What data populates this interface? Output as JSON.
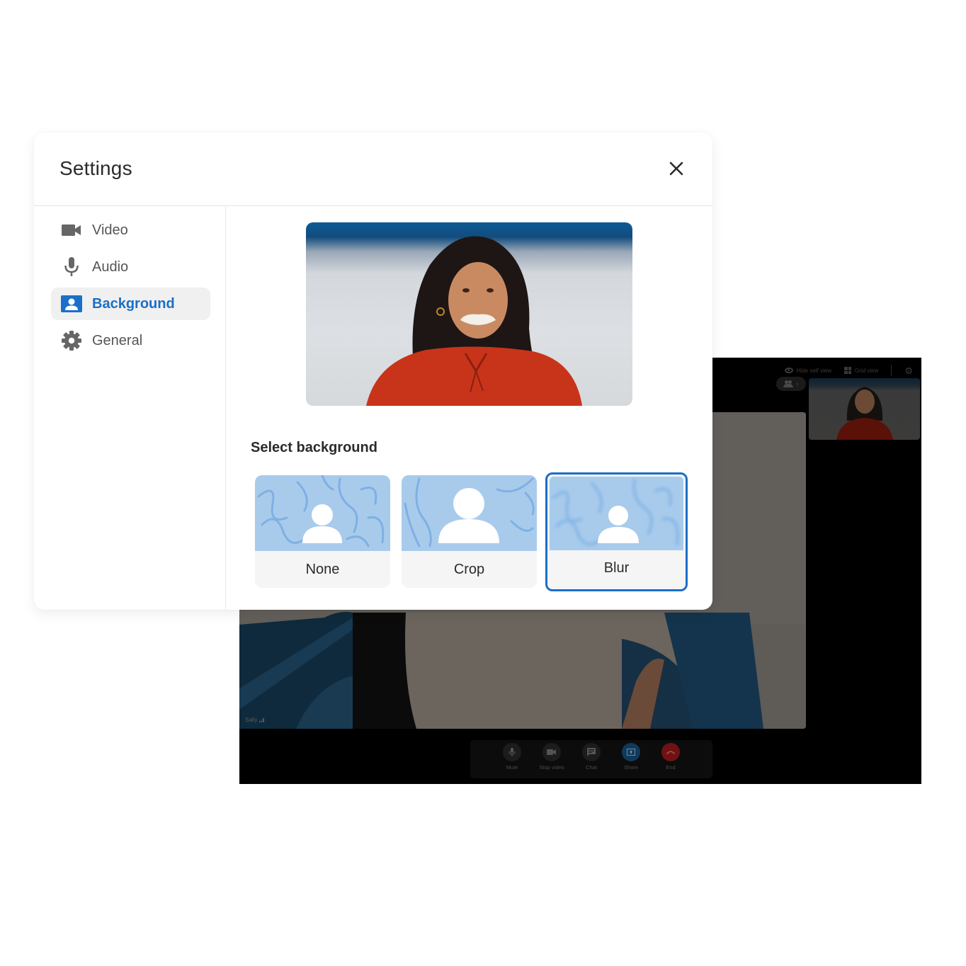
{
  "dialog": {
    "title": "Settings",
    "close_icon": "close-icon"
  },
  "sidebar": {
    "items": [
      {
        "label": "Video",
        "icon": "video-camera-icon",
        "active": false
      },
      {
        "label": "Audio",
        "icon": "microphone-icon",
        "active": false
      },
      {
        "label": "Background",
        "icon": "person-portrait-icon",
        "active": true
      },
      {
        "label": "General",
        "icon": "gear-icon",
        "active": false
      }
    ]
  },
  "content": {
    "section_label": "Select background",
    "options": [
      {
        "label": "None",
        "selected": false
      },
      {
        "label": "Crop",
        "selected": false
      },
      {
        "label": "Blur",
        "selected": true
      }
    ]
  },
  "meeting": {
    "topbar": {
      "hide_self_view": "Hide self view",
      "grid_view": "Grid view"
    },
    "participant_name": "Sally",
    "controls": [
      {
        "label": "Mute",
        "icon": "microphone-icon"
      },
      {
        "label": "Stop video",
        "icon": "video-camera-icon"
      },
      {
        "label": "Chat",
        "icon": "chat-icon"
      },
      {
        "label": "Share",
        "icon": "share-screen-icon"
      },
      {
        "label": "End",
        "icon": "end-call-icon"
      }
    ]
  },
  "colors": {
    "accent": "#1a6fc9",
    "thumb_bg": "#a8cbec",
    "share": "#103a5a",
    "end": "#701212"
  }
}
